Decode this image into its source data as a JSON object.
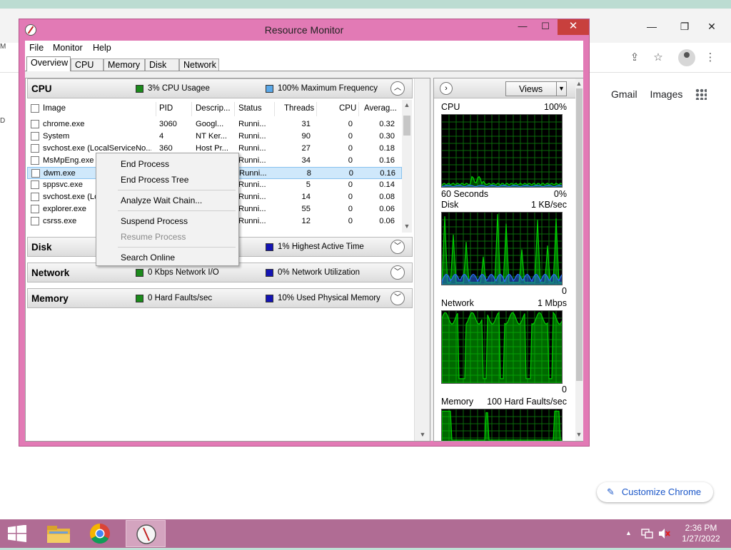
{
  "chrome": {
    "links": [
      "Gmail",
      "Images"
    ],
    "customize_label": "Customize Chrome"
  },
  "rm": {
    "title": "Resource Monitor",
    "menu": [
      "File",
      "Monitor",
      "Help"
    ],
    "tabs": [
      "Overview",
      "CPU",
      "Memory",
      "Disk",
      "Network"
    ],
    "active_tab": "Overview",
    "cpu": {
      "title": "CPU",
      "legend1": "3% CPU Usagee",
      "legend2": "100% Maximum Frequency",
      "columns": [
        "Image",
        "PID",
        "Descrip...",
        "Status",
        "Threads",
        "CPU",
        "Averag..."
      ],
      "rows": [
        {
          "image": "chrome.exe",
          "pid": "3060",
          "desc": "Googl...",
          "status": "Runni...",
          "threads": "31",
          "cpu": "0",
          "avg": "0.32"
        },
        {
          "image": "System",
          "pid": "4",
          "desc": "NT Ker...",
          "status": "Runni...",
          "threads": "90",
          "cpu": "0",
          "avg": "0.30"
        },
        {
          "image": "svchost.exe (LocalServiceNo...",
          "pid": "360",
          "desc": "Host Pr...",
          "status": "Runni...",
          "threads": "27",
          "cpu": "0",
          "avg": "0.18"
        },
        {
          "image": "MsMpEng.exe",
          "pid": "",
          "desc": "",
          "status": "Runni...",
          "threads": "34",
          "cpu": "0",
          "avg": "0.16"
        },
        {
          "image": "dwm.exe",
          "pid": "",
          "desc": "",
          "status": "Runni...",
          "threads": "8",
          "cpu": "0",
          "avg": "0.16"
        },
        {
          "image": "sppsvc.exe",
          "pid": "",
          "desc": "",
          "status": "Runni...",
          "threads": "5",
          "cpu": "0",
          "avg": "0.14"
        },
        {
          "image": "svchost.exe (Lo",
          "pid": "",
          "desc": "",
          "status": "Runni...",
          "threads": "14",
          "cpu": "0",
          "avg": "0.08"
        },
        {
          "image": "explorer.exe",
          "pid": "",
          "desc": "",
          "status": "Runni...",
          "threads": "55",
          "cpu": "0",
          "avg": "0.06"
        },
        {
          "image": "csrss.exe",
          "pid": "",
          "desc": "",
          "status": "Runni...",
          "threads": "12",
          "cpu": "0",
          "avg": "0.06"
        }
      ]
    },
    "disk": {
      "title": "Disk",
      "legend2": "1% Highest Active Time"
    },
    "network": {
      "title": "Network",
      "legend1": "0 Kbps Network I/O",
      "legend2": "0% Network Utilization"
    },
    "memory": {
      "title": "Memory",
      "legend1": "0 Hard Faults/sec",
      "legend2": "10% Used Physical Memory"
    },
    "views_label": "Views",
    "graphs": {
      "cpu": {
        "label": "CPU",
        "max": "100%",
        "time": "60 Seconds",
        "min": "0%"
      },
      "disk": {
        "label": "Disk",
        "max": "1 KB/sec",
        "min": "0"
      },
      "network": {
        "label": "Network",
        "max": "1 Mbps",
        "min": "0"
      },
      "memory": {
        "label": "Memory",
        "max": "100 Hard Faults/sec"
      }
    },
    "context_menu": {
      "end_process": "End Process",
      "end_process_tree": "End Process Tree",
      "analyze_wait_chain": "Analyze Wait Chain...",
      "suspend_process": "Suspend Process",
      "resume_process": "Resume Process",
      "search_online": "Search Online"
    }
  },
  "taskbar": {
    "time": "2:36 PM",
    "date": "1/27/2022"
  },
  "colors": {
    "window_border": "#e27ab5",
    "graph_green": "#00d200",
    "graph_blue": "#2c6cff",
    "taskbar": "#b06c94"
  }
}
